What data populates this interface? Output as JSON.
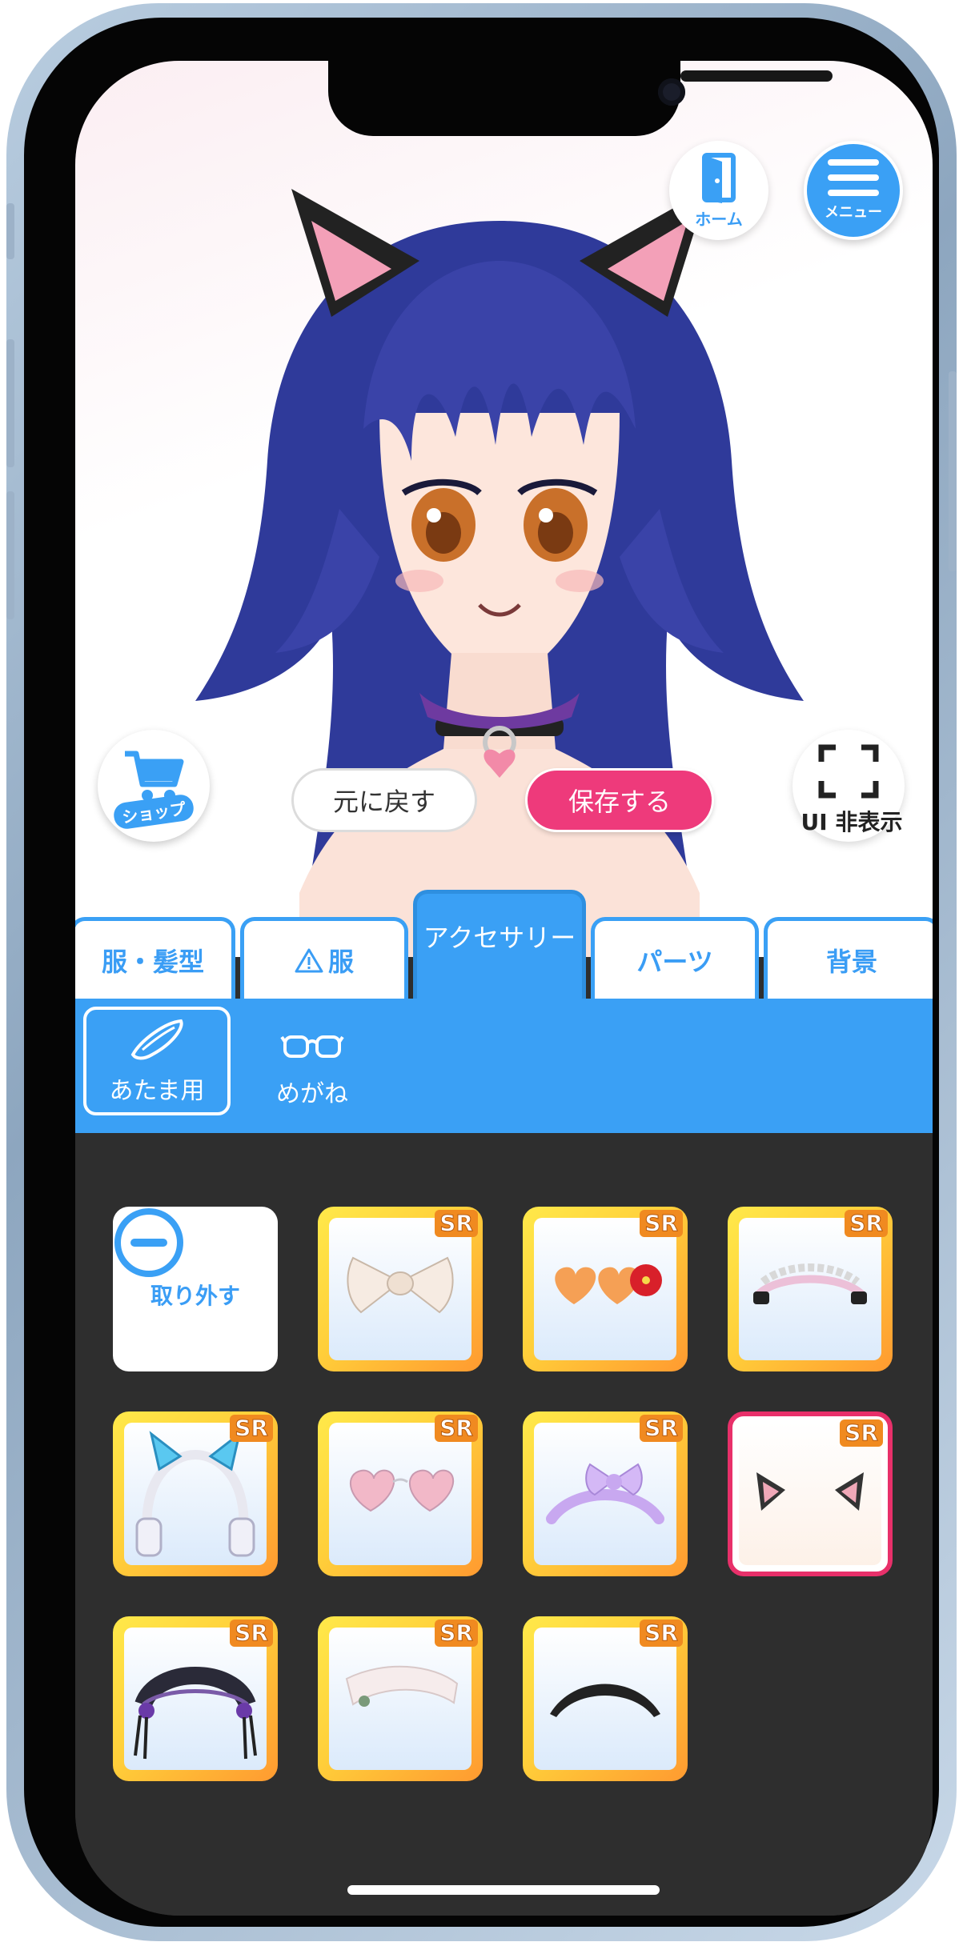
{
  "top_buttons": {
    "home_label": "ホーム",
    "menu_label": "メニュー"
  },
  "stage_buttons": {
    "shop_label": "ショップ",
    "ui_hide_label": "UI 非表示",
    "undo_label": "元に戻す",
    "save_label": "保存する"
  },
  "tabs": [
    {
      "label": "服・髪型",
      "active": false
    },
    {
      "label": "服",
      "warning": true,
      "active": false
    },
    {
      "label": "アクセサリー",
      "active": true
    },
    {
      "label": "パーツ",
      "active": false
    },
    {
      "label": "背景",
      "active": false
    }
  ],
  "subcategories": [
    {
      "label": "あたま用",
      "icon": "hairpin-icon",
      "active": true
    },
    {
      "label": "めがね",
      "icon": "glasses-icon",
      "active": false
    }
  ],
  "items": {
    "remove_label": "取り外す",
    "rarity": "SR",
    "list": [
      {
        "icon": "white-bow-icon",
        "rarity": "SR",
        "selected": false
      },
      {
        "icon": "heart-sunglasses-flower-icon",
        "rarity": "SR",
        "selected": false
      },
      {
        "icon": "maid-headband-icon",
        "rarity": "SR",
        "selected": false
      },
      {
        "icon": "cat-ear-headphones-icon",
        "rarity": "SR",
        "selected": false
      },
      {
        "icon": "heart-glasses-icon",
        "rarity": "SR",
        "selected": false
      },
      {
        "icon": "lavender-ribbon-headband-icon",
        "rarity": "SR",
        "selected": false
      },
      {
        "icon": "cat-ears-icon",
        "rarity": "SR",
        "selected": true
      },
      {
        "icon": "gothic-headdress-icon",
        "rarity": "SR",
        "selected": false
      },
      {
        "icon": "white-headband-icon",
        "rarity": "SR",
        "selected": false
      },
      {
        "icon": "black-hairband-icon",
        "rarity": "SR",
        "selected": false
      }
    ]
  },
  "colors": {
    "accent": "#3aa0f5",
    "save": "#ee3a7b",
    "selected_border": "#e8306a",
    "grid_bg": "#2e2e2e"
  }
}
